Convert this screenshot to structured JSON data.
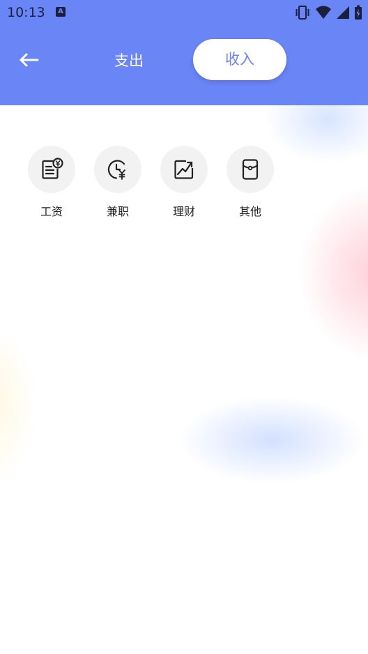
{
  "status_bar": {
    "time": "10:13",
    "notification_icon_letter": "A"
  },
  "header": {
    "background_color": "#6a85f6",
    "tabs": [
      {
        "label": "支出",
        "selected": false
      },
      {
        "label": "收入",
        "selected": true
      }
    ]
  },
  "categories": [
    {
      "label": "工资",
      "icon": "salary-doc-icon"
    },
    {
      "label": "兼职",
      "icon": "part-time-clock-icon"
    },
    {
      "label": "理财",
      "icon": "investment-chart-icon"
    },
    {
      "label": "其他",
      "icon": "other-wallet-icon"
    }
  ]
}
